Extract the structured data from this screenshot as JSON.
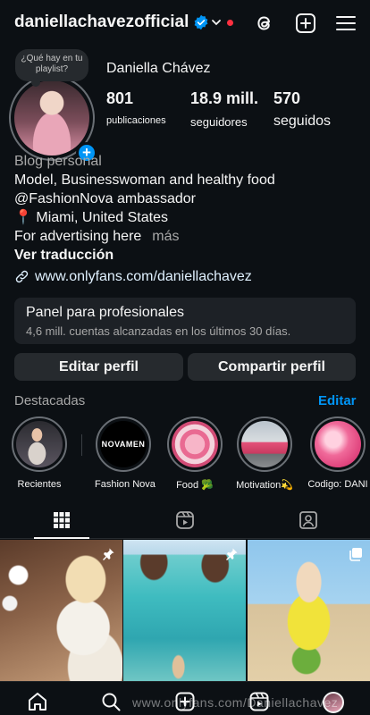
{
  "header": {
    "username": "daniellachavezofficial",
    "icons": [
      "verified-badge-icon",
      "chevron-down-icon",
      "notification-dot",
      "threads-icon",
      "new-post-icon",
      "menu-icon"
    ]
  },
  "profile": {
    "note": "¿Qué hay en tu playlist?",
    "add_icon": "+",
    "full_name": "Daniella Chávez",
    "stats": {
      "posts_value": "801",
      "posts_label": "publicaciones",
      "followers_value": "18.9 mill.",
      "followers_label": "seguidores",
      "following_value": "570",
      "following_label": "seguidos"
    }
  },
  "bio": {
    "category": "Blog personal",
    "line1": "Model, Businesswoman and healthy food",
    "line2": "@FashionNova ambassador",
    "line3": "📍 Miami, United States",
    "line4": "For advertising here",
    "more": "más",
    "translate": "Ver traducción",
    "link": "www.onlyfans.com/daniellachavez"
  },
  "dashboard": {
    "title": "Panel para profesionales",
    "subtitle": "4,6 mill. cuentas alcanzadas en los últimos 30 días."
  },
  "buttons": {
    "edit_profile": "Editar perfil",
    "share_profile": "Compartir perfil"
  },
  "highlights": {
    "title": "Destacadas",
    "edit": "Editar",
    "items": [
      {
        "label": "Recientes"
      },
      {
        "label": "Fashion Nova",
        "logo_text": "NOVAMEN"
      },
      {
        "label": "Food 🥦"
      },
      {
        "label": "Motivation💫"
      },
      {
        "label": "Codigo: DANI"
      }
    ]
  },
  "tabs": {
    "active": "grid",
    "items": [
      "grid-icon",
      "reels-icon",
      "tagged-icon"
    ]
  },
  "watermark": "www.onlyfans.com/Daniellachavez",
  "colors": {
    "background": "#0c1014",
    "accent": "#0095f6",
    "secondary_text": "#a8a8a8",
    "button_bg": "#262a2e",
    "notification_dot": "#ff3040"
  }
}
